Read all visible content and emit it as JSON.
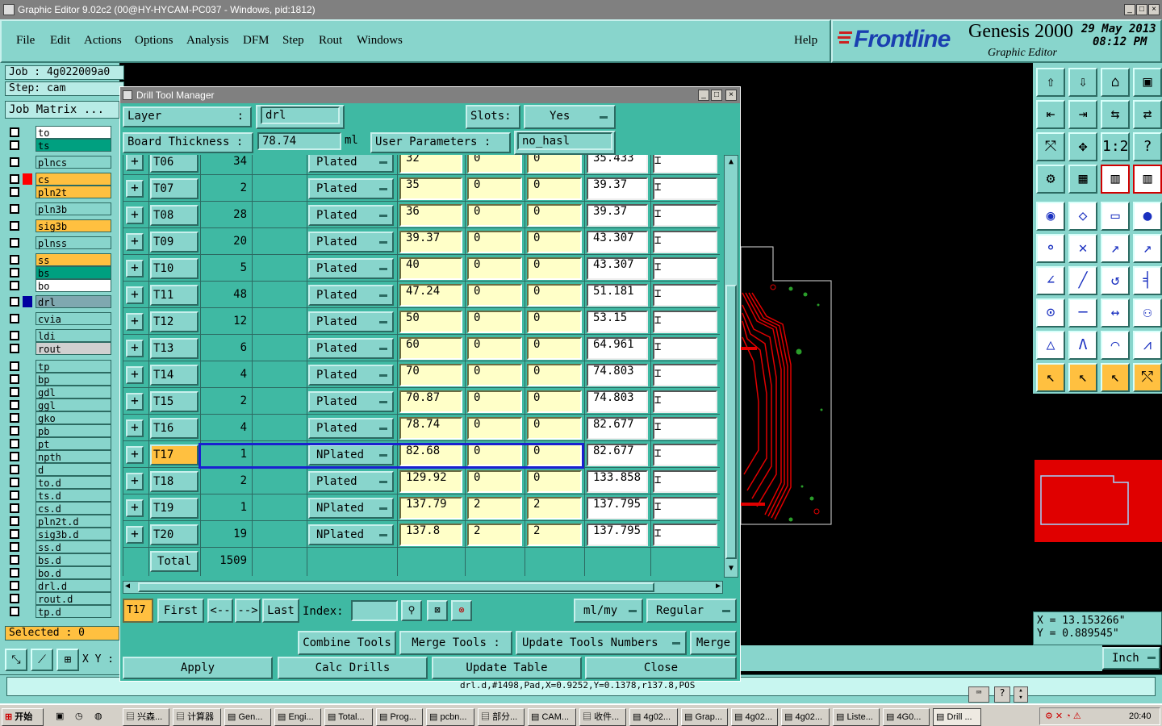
{
  "window": {
    "title": "Graphic Editor 9.02c2 (00@HY-HYCAM-PC037 - Windows, pid:1812)"
  },
  "menu": [
    "File",
    "Edit",
    "Actions",
    "Options",
    "Analysis",
    "DFM",
    "Step",
    "Rout",
    "Windows"
  ],
  "help_label": "Help",
  "brand": {
    "logo": "Frontline",
    "product": "Genesis 2000",
    "subtitle": "Graphic Editor",
    "date": "29 May 2013",
    "time": "08:12 PM"
  },
  "left": {
    "job": "Job : 4g022009a0",
    "step": "Step: cam",
    "job_matrix": "Job Matrix ...",
    "layers": [
      {
        "name": "to",
        "color": "#ffffff"
      },
      {
        "name": "ts",
        "color": "#00a080"
      },
      {
        "name": "plncs",
        "color": "#88d5cc"
      },
      {
        "name": "cs",
        "color": "#ffc040",
        "swatch": "#ff0000"
      },
      {
        "name": "pln2t",
        "color": "#ffc040"
      },
      {
        "name": "pln3b",
        "color": "#88d5cc"
      },
      {
        "name": "sig3b",
        "color": "#ffc040"
      },
      {
        "name": "plnss",
        "color": "#88d5cc"
      },
      {
        "name": "ss",
        "color": "#ffc040"
      },
      {
        "name": "bs",
        "color": "#00a080"
      },
      {
        "name": "bo",
        "color": "#ffffff"
      },
      {
        "name": "drl",
        "color": "#7fa8b0",
        "swatch": "#0000a0"
      },
      {
        "name": "cvia",
        "color": "#88d5cc"
      },
      {
        "name": "ldi",
        "color": "#88d5cc"
      },
      {
        "name": "rout",
        "color": "#d0d0d0"
      },
      {
        "name": "tp",
        "color": "#88d5cc"
      },
      {
        "name": "bp",
        "color": "#88d5cc"
      },
      {
        "name": "gdl",
        "color": "#88d5cc"
      },
      {
        "name": "ggl",
        "color": "#88d5cc"
      },
      {
        "name": "gko",
        "color": "#88d5cc"
      },
      {
        "name": "pb",
        "color": "#88d5cc"
      },
      {
        "name": "pt",
        "color": "#88d5cc"
      },
      {
        "name": "npth",
        "color": "#88d5cc"
      },
      {
        "name": "d",
        "color": "#88d5cc"
      },
      {
        "name": "to.d",
        "color": "#88d5cc"
      },
      {
        "name": "ts.d",
        "color": "#88d5cc"
      },
      {
        "name": "cs.d",
        "color": "#88d5cc"
      },
      {
        "name": "pln2t.d",
        "color": "#88d5cc"
      },
      {
        "name": "sig3b.d",
        "color": "#88d5cc"
      },
      {
        "name": "ss.d",
        "color": "#88d5cc"
      },
      {
        "name": "bs.d",
        "color": "#88d5cc"
      },
      {
        "name": "bo.d",
        "color": "#88d5cc"
      },
      {
        "name": "drl.d",
        "color": "#88d5cc"
      },
      {
        "name": "rout.d",
        "color": "#88d5cc"
      },
      {
        "name": "tp.d",
        "color": "#88d5cc"
      }
    ],
    "selected": "Selected : 0",
    "xy_label": "X Y :"
  },
  "dialog": {
    "title": "Drill Tool Manager",
    "layer_label": "Layer",
    "layer_colon": ":",
    "layer_value": "drl",
    "slots_label": "Slots:",
    "slots_value": "Yes",
    "thickness_label": "Board Thickness :",
    "thickness_value": "78.74",
    "thickness_unit": "ml",
    "user_params_label": "User Parameters :",
    "user_params_value": "no_hasl",
    "rows": [
      {
        "tool": "T06",
        "count": "34",
        "type": "Plated",
        "size": "32",
        "p1": "0",
        "p2": "0",
        "fin": "35.433"
      },
      {
        "tool": "T07",
        "count": "2",
        "type": "Plated",
        "size": "35",
        "p1": "0",
        "p2": "0",
        "fin": "39.37"
      },
      {
        "tool": "T08",
        "count": "28",
        "type": "Plated",
        "size": "36",
        "p1": "0",
        "p2": "0",
        "fin": "39.37"
      },
      {
        "tool": "T09",
        "count": "20",
        "type": "Plated",
        "size": "39.37",
        "p1": "0",
        "p2": "0",
        "fin": "43.307"
      },
      {
        "tool": "T10",
        "count": "5",
        "type": "Plated",
        "size": "40",
        "p1": "0",
        "p2": "0",
        "fin": "43.307"
      },
      {
        "tool": "T11",
        "count": "48",
        "type": "Plated",
        "size": "47.24",
        "p1": "0",
        "p2": "0",
        "fin": "51.181"
      },
      {
        "tool": "T12",
        "count": "12",
        "type": "Plated",
        "size": "50",
        "p1": "0",
        "p2": "0",
        "fin": "53.15"
      },
      {
        "tool": "T13",
        "count": "6",
        "type": "Plated",
        "size": "60",
        "p1": "0",
        "p2": "0",
        "fin": "64.961"
      },
      {
        "tool": "T14",
        "count": "4",
        "type": "Plated",
        "size": "70",
        "p1": "0",
        "p2": "0",
        "fin": "74.803"
      },
      {
        "tool": "T15",
        "count": "2",
        "type": "Plated",
        "size": "70.87",
        "p1": "0",
        "p2": "0",
        "fin": "74.803"
      },
      {
        "tool": "T16",
        "count": "4",
        "type": "Plated",
        "size": "78.74",
        "p1": "0",
        "p2": "0",
        "fin": "82.677"
      },
      {
        "tool": "T17",
        "count": "1",
        "type": "NPlated",
        "size": "82.68",
        "p1": "0",
        "p2": "0",
        "fin": "82.677",
        "selected": true
      },
      {
        "tool": "T18",
        "count": "2",
        "type": "Plated",
        "size": "129.92",
        "p1": "0",
        "p2": "0",
        "fin": "133.858"
      },
      {
        "tool": "T19",
        "count": "1",
        "type": "NPlated",
        "size": "137.79",
        "p1": "2",
        "p2": "2",
        "fin": "137.795"
      },
      {
        "tool": "T20",
        "count": "19",
        "type": "NPlated",
        "size": "137.8",
        "p1": "2",
        "p2": "2",
        "fin": "137.795"
      }
    ],
    "total_label": "Total",
    "total_value": "1509",
    "nav": {
      "current": "T17",
      "first": "First",
      "prev": "<--",
      "next": "-->",
      "last": "Last",
      "index_label": "Index:",
      "units": "ml/my",
      "mode": "Regular"
    },
    "actions": {
      "combine": "Combine Tools",
      "merge_tools": "Merge Tools :",
      "update_numbers": "Update Tools Numbers",
      "merge": "Merge"
    },
    "footer": {
      "apply": "Apply",
      "calc": "Calc Drills",
      "update": "Update Table",
      "close": "Close"
    }
  },
  "coords": {
    "x": "X = 13.153266\"",
    "y": "Y = 0.889545\""
  },
  "units_btn": "Inch",
  "status_line": "drl.d,#1498,Pad,X=0.9252,Y=0.1378,r137.8,POS",
  "taskbar": {
    "start": "开始",
    "items": [
      "兴森...",
      "计算器",
      "Gen...",
      "Engi...",
      "Total...",
      "Prog...",
      "pcbn...",
      "部分...",
      "CAM...",
      "收件...",
      "4g02...",
      "Grap...",
      "4g02...",
      "4g02...",
      "Liste...",
      "4G0...",
      "Drill ..."
    ],
    "clock": "20:40"
  }
}
